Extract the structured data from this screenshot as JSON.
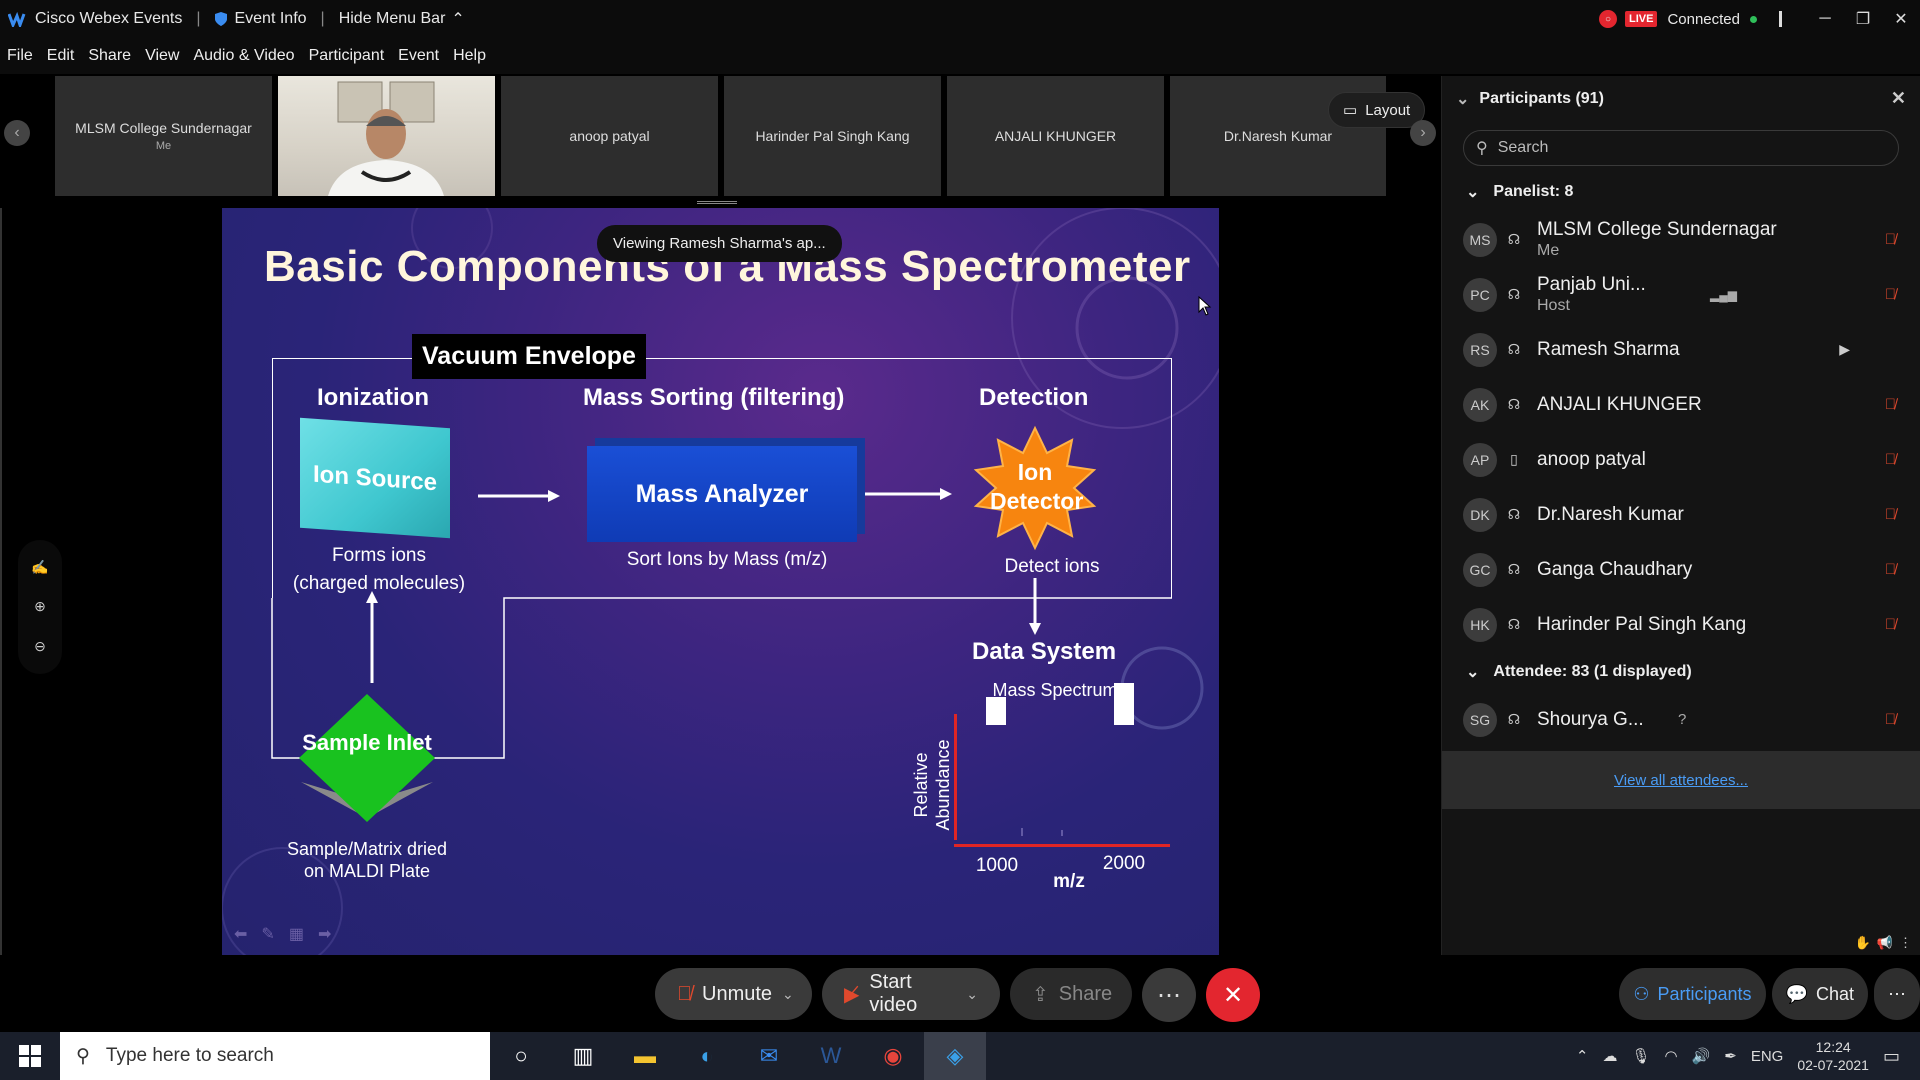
{
  "titlebar": {
    "app_name": "Cisco Webex Events",
    "event_info": "Event Info",
    "hide_menu": "Hide Menu Bar",
    "live_badge": "LIVE",
    "status": "Connected"
  },
  "menu": [
    "File",
    "Edit",
    "Share",
    "View",
    "Audio & Video",
    "Participant",
    "Event",
    "Help"
  ],
  "thumbnails": [
    {
      "name": "MLSM College Sundernagar",
      "sub": "Me"
    },
    {
      "name": "",
      "sub": "",
      "video": true
    },
    {
      "name": "anoop patyal",
      "sub": ""
    },
    {
      "name": "Harinder Pal Singh Kang",
      "sub": ""
    },
    {
      "name": "ANJALI KHUNGER",
      "sub": ""
    },
    {
      "name": "Dr.Naresh Kumar",
      "sub": ""
    }
  ],
  "layout_label": "Layout",
  "viewing_label": "Viewing Ramesh Sharma's ap...",
  "slide": {
    "title": "Basic Components of a Mass Spectrometer",
    "vacuum_envelope": "Vacuum Envelope",
    "ionization": "Ionization",
    "mass_sorting": "Mass Sorting (filtering)",
    "detection": "Detection",
    "ion_source": "Ion Source",
    "mass_analyzer": "Mass Analyzer",
    "ion_detector": "Ion Detector",
    "forms_ions_1": "Forms ions",
    "forms_ions_2": "(charged molecules)",
    "sort_ions": "Sort Ions by Mass (m/z)",
    "detect_ions": "Detect  ions",
    "data_system": "Data System",
    "mass_spectrum": "Mass Spectrum",
    "rel_abundance_1": "Relative",
    "rel_abundance_2": "Abundance",
    "tick_1000": "1000",
    "tick_2000": "2000",
    "mz": "m/z",
    "sample_inlet": "Sample Inlet",
    "sample_matrix_1": "Sample/Matrix dried",
    "sample_matrix_2": "on MALDI Plate"
  },
  "panel": {
    "title": "Participants (91)",
    "search_placeholder": "Search",
    "panelist_header": "Panelist: 8",
    "attendee_header": "Attendee: 83 (1 displayed)",
    "panelists": [
      {
        "initials": "MS",
        "name": "MLSM College Sundernagar",
        "sub": "Me",
        "muted": true
      },
      {
        "initials": "PC",
        "name": "Panjab Uni...",
        "sub": "Host",
        "muted": true
      },
      {
        "initials": "RS",
        "name": "Ramesh Sharma",
        "sub": "",
        "muted": false
      },
      {
        "initials": "AK",
        "name": "ANJALI KHUNGER",
        "sub": "",
        "muted": true
      },
      {
        "initials": "AP",
        "name": "anoop patyal",
        "sub": "",
        "muted": true
      },
      {
        "initials": "DK",
        "name": "Dr.Naresh Kumar",
        "sub": "",
        "muted": true
      },
      {
        "initials": "GC",
        "name": "Ganga Chaudhary",
        "sub": "",
        "muted": true
      },
      {
        "initials": "HK",
        "name": "Harinder Pal Singh Kang",
        "sub": "",
        "muted": true
      }
    ],
    "attendees": [
      {
        "initials": "SG",
        "name": "Shourya G...",
        "sub": "",
        "muted": true
      }
    ],
    "view_all": "View all attendees..."
  },
  "controls": {
    "unmute": "Unmute",
    "start_video": "Start video",
    "share": "Share",
    "participants": "Participants",
    "chat": "Chat"
  },
  "taskbar": {
    "search_placeholder": "Type here to search",
    "lang": "ENG",
    "time": "12:24",
    "date": "02-07-2021"
  }
}
